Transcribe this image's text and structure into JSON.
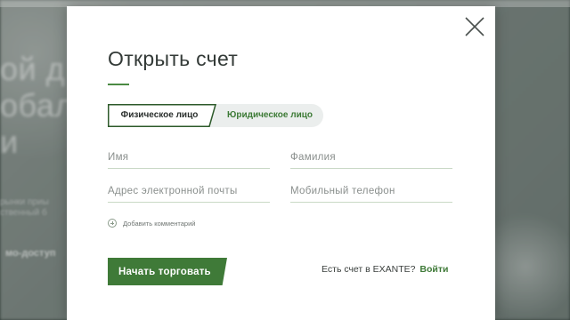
{
  "background": {
    "headline_lines": [
      "ой д",
      "обал",
      "и"
    ],
    "small_lines": [
      "рынки приы",
      "ственный б"
    ],
    "link_text": "мо-доступ"
  },
  "modal": {
    "title": "Открыть счет",
    "tabs": [
      {
        "label": "Физическое лицо",
        "active": true
      },
      {
        "label": "Юридическое лицо",
        "active": false
      }
    ],
    "fields": {
      "first_name": {
        "placeholder": "Имя",
        "value": ""
      },
      "last_name": {
        "placeholder": "Фамилия",
        "value": ""
      },
      "email": {
        "placeholder": "Адрес электронной почты",
        "value": ""
      },
      "phone": {
        "placeholder": "Мобильный телефон",
        "value": ""
      }
    },
    "add_comment_label": "Добавить комментарий",
    "submit_label": "Начать торговать",
    "account_prompt": "Есть счет в EXANTE?",
    "login_label": "Войти",
    "icons": {
      "close": "close-icon",
      "add": "plus-circle-icon"
    }
  },
  "colors": {
    "accent": "#3f7a38",
    "tab_border": "#2d5a2a",
    "input_underline": "#c9d9c6"
  }
}
